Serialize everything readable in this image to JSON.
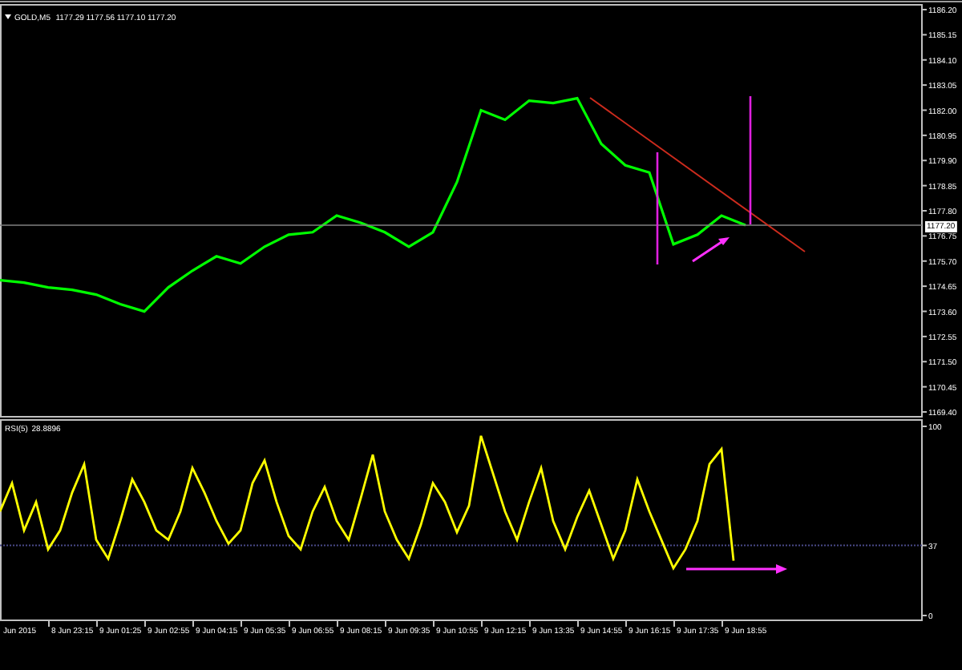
{
  "price_panel": {
    "symbol": "GOLD,M5",
    "quote": "1177.29 1177.56 1177.10 1177.20",
    "current_price": "1177.20",
    "price_scale": [
      "1186.20",
      "1185.15",
      "1184.10",
      "1183.05",
      "1182.00",
      "1180.95",
      "1179.90",
      "1178.85",
      "1177.80",
      "1176.75",
      "1175.70",
      "1174.65",
      "1173.60",
      "1172.55",
      "1171.50",
      "1170.45",
      "1169.40"
    ]
  },
  "rsi_panel": {
    "name": "RSI(5)",
    "reading": "28.8896",
    "scale": [
      "100",
      "37",
      "0"
    ]
  },
  "time_axis": [
    "Jun 2015",
    "8 Jun 23:15",
    "9 Jun 01:25",
    "9 Jun 02:55",
    "9 Jun 04:15",
    "9 Jun 05:35",
    "9 Jun 06:55",
    "9 Jun 08:15",
    "9 Jun 09:35",
    "9 Jun 10:55",
    "9 Jun 12:15",
    "9 Jun 13:35",
    "9 Jun 14:55",
    "9 Jun 16:15",
    "9 Jun 17:35",
    "9 Jun 18:55"
  ]
}
